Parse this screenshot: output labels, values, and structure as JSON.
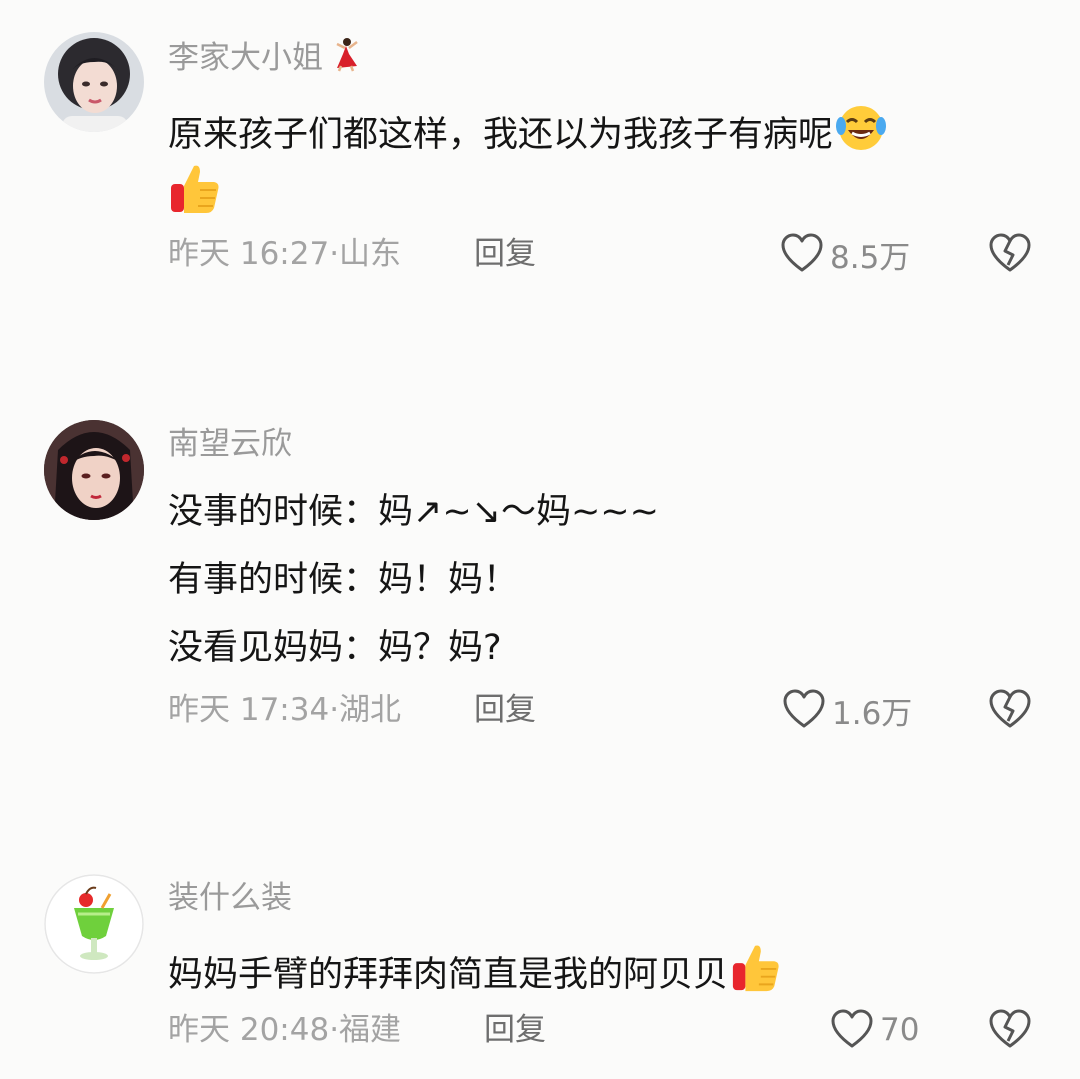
{
  "comments": [
    {
      "author": "李家大小姐",
      "author_badge_icon": "dancer-emoji",
      "lines": [
        "原来孩子们都这样，我还以为我孩子有病呢"
      ],
      "emojis": [
        "laughing-crying-emoji",
        "thumbs-up-emoji"
      ],
      "time": "昨天 16:27·",
      "location": "山东",
      "reply_label": "回复",
      "likes": "8.5万"
    },
    {
      "author": "南望云欣",
      "lines": [
        "没事的时候：妈↗~↘～妈~~~",
        "有事的时候：妈！妈！",
        "没看见妈妈：妈？妈?"
      ],
      "time": "昨天 17:34·",
      "location": "湖北",
      "reply_label": "回复",
      "likes": "1.6万"
    },
    {
      "author": "装什么装",
      "lines": [
        "妈妈手臂的拜拜肉简直是我的阿贝贝"
      ],
      "emojis": [
        "thumbs-up-emoji"
      ],
      "time": "昨天 20:48·",
      "location": "福建",
      "reply_label": "回复",
      "likes": "70"
    }
  ],
  "icons": {
    "like": "heart-outline-icon",
    "dislike": "broken-heart-icon"
  },
  "colors": {
    "background": "#fbfbfa",
    "author_text": "#9a9a9a",
    "meta_text": "#a3a3a3",
    "icon_stroke": "#555555"
  }
}
